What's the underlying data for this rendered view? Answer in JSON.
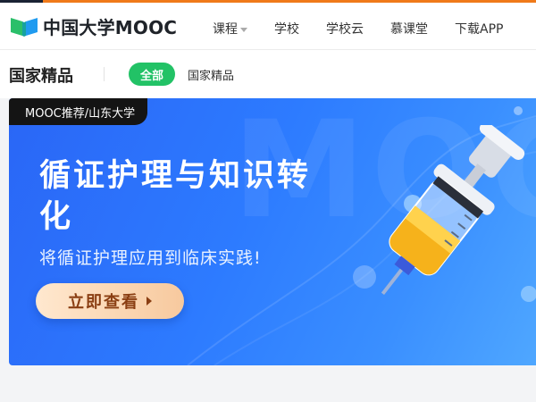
{
  "site": {
    "logo_text": "中国大学MOOC",
    "brand_color": "#22c266"
  },
  "nav": {
    "items": [
      {
        "label": "课程",
        "has_dropdown": true
      },
      {
        "label": "学校"
      },
      {
        "label": "学校云"
      },
      {
        "label": "慕课堂"
      },
      {
        "label": "下载APP"
      }
    ]
  },
  "section": {
    "title": "国家精品",
    "filters": [
      {
        "label": "全部",
        "active": true
      },
      {
        "label": "国家精品",
        "active": false
      }
    ]
  },
  "banner": {
    "source_tag": "MOOC推荐/山东大学",
    "headline": "循证护理与知识转化",
    "subline": "将循证护理应用到临床实践!",
    "cta_label": "立即查看",
    "background_watermark": "MOOC"
  }
}
